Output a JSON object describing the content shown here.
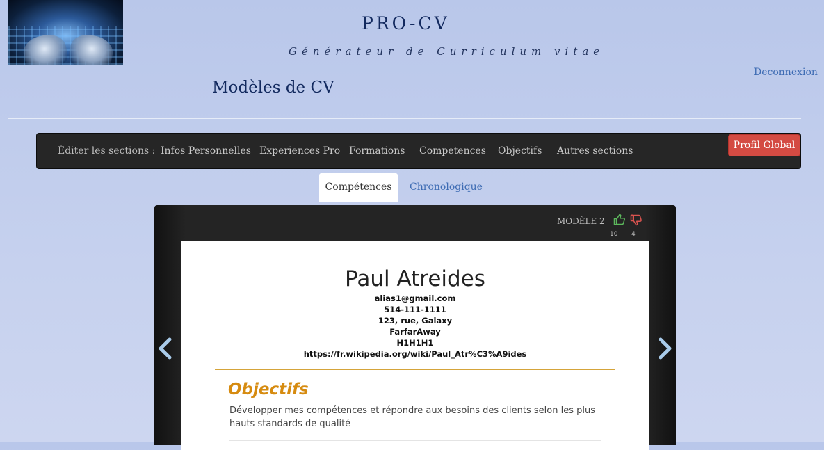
{
  "header": {
    "brand": "PRO-CV",
    "tagline": "Générateur de Curriculum vitae",
    "logout_label": "Deconnexion",
    "page_title": "Modèles de CV"
  },
  "navbar": {
    "label": "Éditer les sections :",
    "items": [
      "Infos Personnelles",
      "Experiences Pro",
      "Formations",
      "Competences",
      "Objectifs",
      "Autres sections"
    ],
    "profile_button": "Profil Global"
  },
  "tabs": [
    {
      "label": "Compétences",
      "active": true
    },
    {
      "label": "Chronologique",
      "active": false
    }
  ],
  "viewer": {
    "model_label": "MODÈLE 2",
    "likes": "10",
    "dislikes": "4",
    "icons": {
      "like": "thumbs-up-icon",
      "dislike": "thumbs-down-icon",
      "prev": "chevron-left-icon",
      "next": "chevron-right-icon"
    },
    "colors": {
      "like": "#5cb85c",
      "dislike": "#d9534f",
      "accent": "#d68b10"
    }
  },
  "cv": {
    "name": "Paul Atreides",
    "email": "alias1@gmail.com",
    "phone": "514-111-1111",
    "address": "123, rue, Galaxy",
    "city": "FarfarAway",
    "postal": "H1H1H1",
    "website": "https://fr.wikipedia.org/wiki/Paul_Atr%C3%A9ides",
    "objectives_title": "Objectifs",
    "objectives_text": "Développer mes compétences et répondre aux besoins des clients selon les plus hauts standards de qualité"
  }
}
